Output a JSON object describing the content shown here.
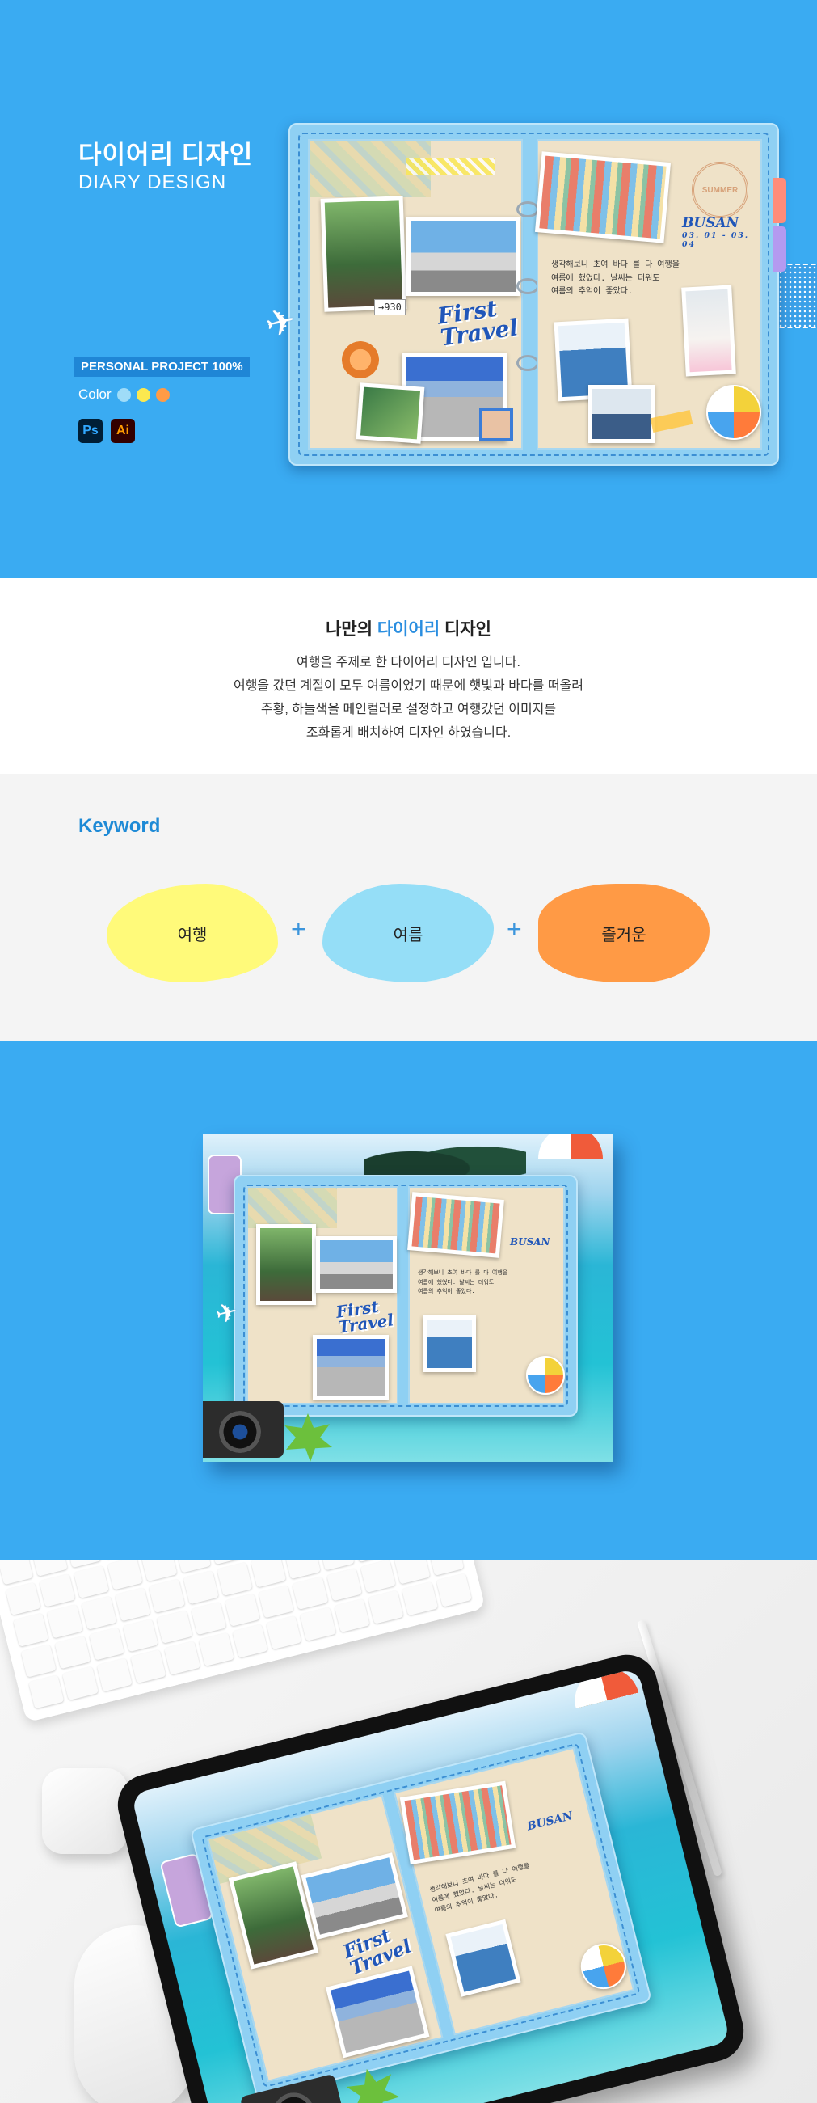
{
  "hero": {
    "title_ko": "다이어리 디자인",
    "title_en": "DIARY DESIGN",
    "badge": "PERSONAL PROJECT 100%",
    "color_label": "Color",
    "colors": [
      "#9fdcf8",
      "#fbe84f",
      "#ff9b45"
    ],
    "apps": [
      "Ps",
      "Ai"
    ]
  },
  "diary": {
    "title": "First Travel",
    "title_line1": "First",
    "title_line2": "Travel",
    "place": "BUSAN",
    "date": "03. 01 - 03. 04",
    "stamp": "SUMMER",
    "ticket": "930",
    "note_lines": [
      "생각해보니 초여 바다 를 다 여행을",
      "여름에 했었다. 날씨는 더워도",
      "여름의 추억이 좋았다."
    ],
    "note_highlights": [
      "초여",
      "바다"
    ]
  },
  "intro": {
    "heading_prefix": "나만의 ",
    "heading_accent": "다이어리",
    "heading_suffix": " 디자인",
    "lines": [
      "여행을 주제로 한 다이어리 디자인 입니다.",
      "여행을 갔던 계절이 모두 여름이었기 때문에 햇빛과 바다를 떠올려",
      "주황, 하늘색을 메인컬러로 설정하고 여행갔던 이미지를",
      "조화롭게 배치하여 디자인 하였습니다."
    ]
  },
  "keyword": {
    "title": "Keyword",
    "items": [
      {
        "label": "여행",
        "color": "#fffa7a"
      },
      {
        "label": "여름",
        "color": "#95def7"
      },
      {
        "label": "즐거운",
        "color": "#ff9a45"
      }
    ],
    "plus": "+"
  },
  "theme": {
    "bg_blue": "#3aabf2",
    "accent_blue": "#1e8ad6"
  }
}
